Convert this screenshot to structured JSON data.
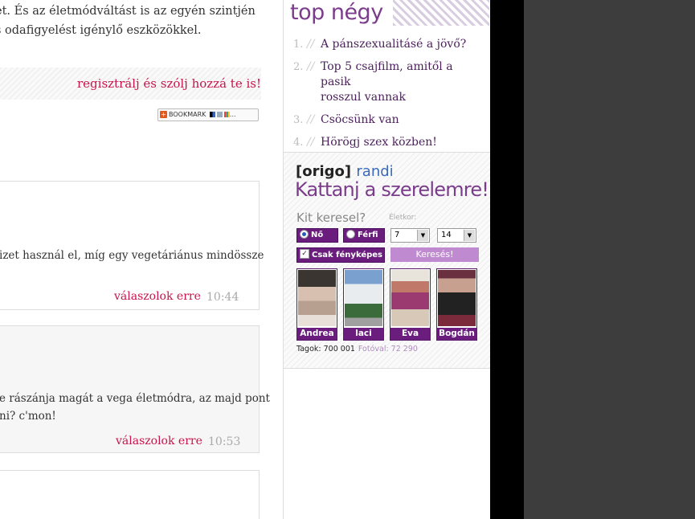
{
  "article": {
    "line1": "et. És az életmódváltást is az egyén szintjén",
    "line2": "s odafigyelést igénylő eszközökkel."
  },
  "register_link": "regisztrálj és szólj hozzá te is!",
  "bookmark_label": "BOOKMARK",
  "comments": [
    {
      "line1": "izet használ el, míg egy vegetáriánus mindössze",
      "line2": "",
      "reply": "válaszolok erre",
      "time": "10:44"
    },
    {
      "line1": "e rászánja magát a vega életmódra, az majd pont",
      "line2": "ni? c'mon!",
      "reply": "válaszolok erre",
      "time": "10:53"
    }
  ],
  "sidebar": {
    "top_title": "top négy",
    "top_items": [
      {
        "num": "1.",
        "sep": "//",
        "text1": "A pánszexualitásé a jövő?",
        "text2": ""
      },
      {
        "num": "2.",
        "sep": "//",
        "text1": "Top 5 csajfilm, amitől a pasik",
        "text2": "rosszul vannak"
      },
      {
        "num": "3.",
        "sep": "//",
        "text1": "Csöcsünk van",
        "text2": ""
      },
      {
        "num": "4.",
        "sep": "//",
        "text1": "Hörögj szex közben!",
        "text2": ""
      }
    ],
    "randi": {
      "brand": "[origo]",
      "brand_suffix": "randi",
      "slogan": "Kattanj a szerelemre!",
      "search_title": "Kit keresel?",
      "age_label": "Életkor:",
      "radio_female": "Nő",
      "radio_male": "Férfi",
      "age_from": "7",
      "age_to": "14",
      "photo_only": "Csak fényképes",
      "search_button": "Keresés!",
      "profiles": [
        "Andrea",
        "laci",
        "Eva",
        "Bogdán"
      ],
      "members_label": "Tagok: 700 001",
      "with_photo_label": "Fotóval: 72 290"
    }
  }
}
